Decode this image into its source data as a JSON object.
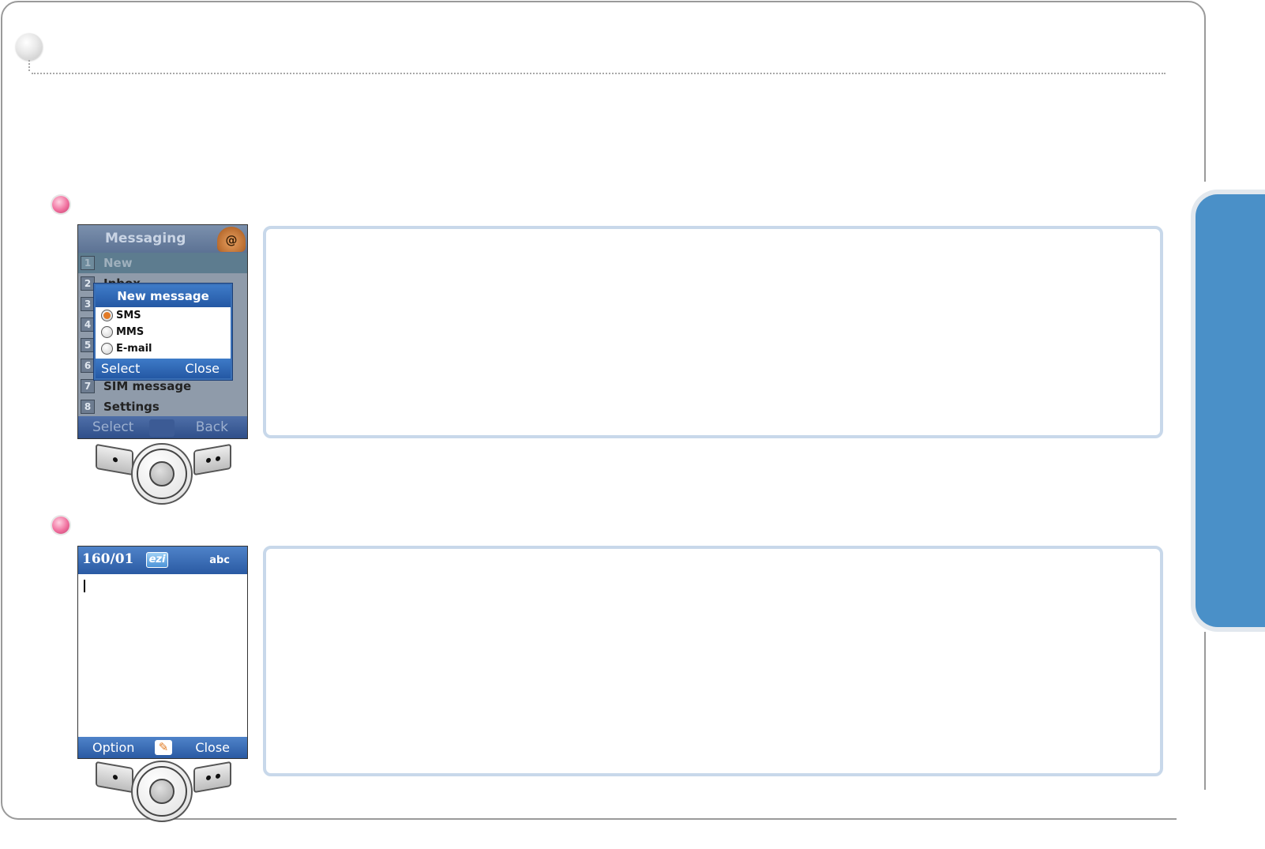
{
  "step1_screen": {
    "title": "Messaging",
    "title_icon_glyph": "@",
    "menu": [
      {
        "num": "1",
        "label": "New"
      },
      {
        "num": "2",
        "label": "Inbox"
      },
      {
        "num": "3",
        "label": ""
      },
      {
        "num": "4",
        "label": ""
      },
      {
        "num": "5",
        "label": ""
      },
      {
        "num": "6",
        "label": ""
      },
      {
        "num": "7",
        "label": "SIM message"
      },
      {
        "num": "8",
        "label": "Settings"
      }
    ],
    "popup": {
      "title": "New message",
      "options": [
        "SMS",
        "MMS",
        "E-mail"
      ],
      "selected": "SMS",
      "soft_left": "Select",
      "soft_right": "Close"
    },
    "soft_left": "Select",
    "soft_right": "Back"
  },
  "step2_screen": {
    "counter": "160/01",
    "ezi_label": "ezi",
    "input_mode": "abc",
    "soft_left": "Option",
    "soft_right": "Close"
  },
  "colors": {
    "accent_blue": "#4a90c8",
    "box_border": "#c8d8ea",
    "bullet_pink": "#f0709e"
  }
}
